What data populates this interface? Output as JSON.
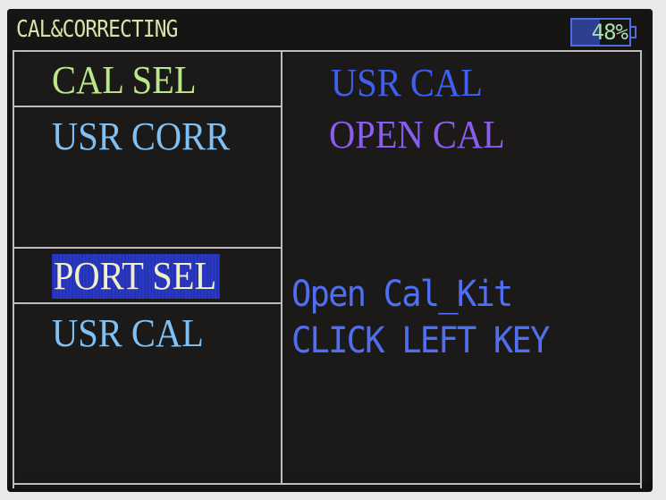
{
  "header": {
    "title": "CAL&CORRECTING",
    "battery": {
      "label": "48%",
      "level": 0.48
    }
  },
  "left_menu": {
    "items": [
      {
        "label": "CAL SEL",
        "color": "#b9e88a",
        "selected": false
      },
      {
        "label": "USR CORR",
        "color": "#7fc0f5",
        "selected": false
      },
      {
        "label": "PORT SEL",
        "color": "#f2f0c8",
        "selected": true
      },
      {
        "label": "USR CAL",
        "color": "#7fc0f5",
        "selected": false
      }
    ]
  },
  "right_panel": {
    "options": [
      {
        "label": "USR CAL",
        "color": "#3f5ff0"
      },
      {
        "label": "OPEN CAL",
        "color": "#8b5cf0"
      }
    ],
    "message": {
      "line1": "Open Cal_Kit",
      "line2": "CLICK LEFT KEY",
      "color": "#4f6ef2"
    }
  },
  "colors": {
    "background": "#1c1a18",
    "frame": "#bdbdbd",
    "selection": "#2a39c8"
  }
}
